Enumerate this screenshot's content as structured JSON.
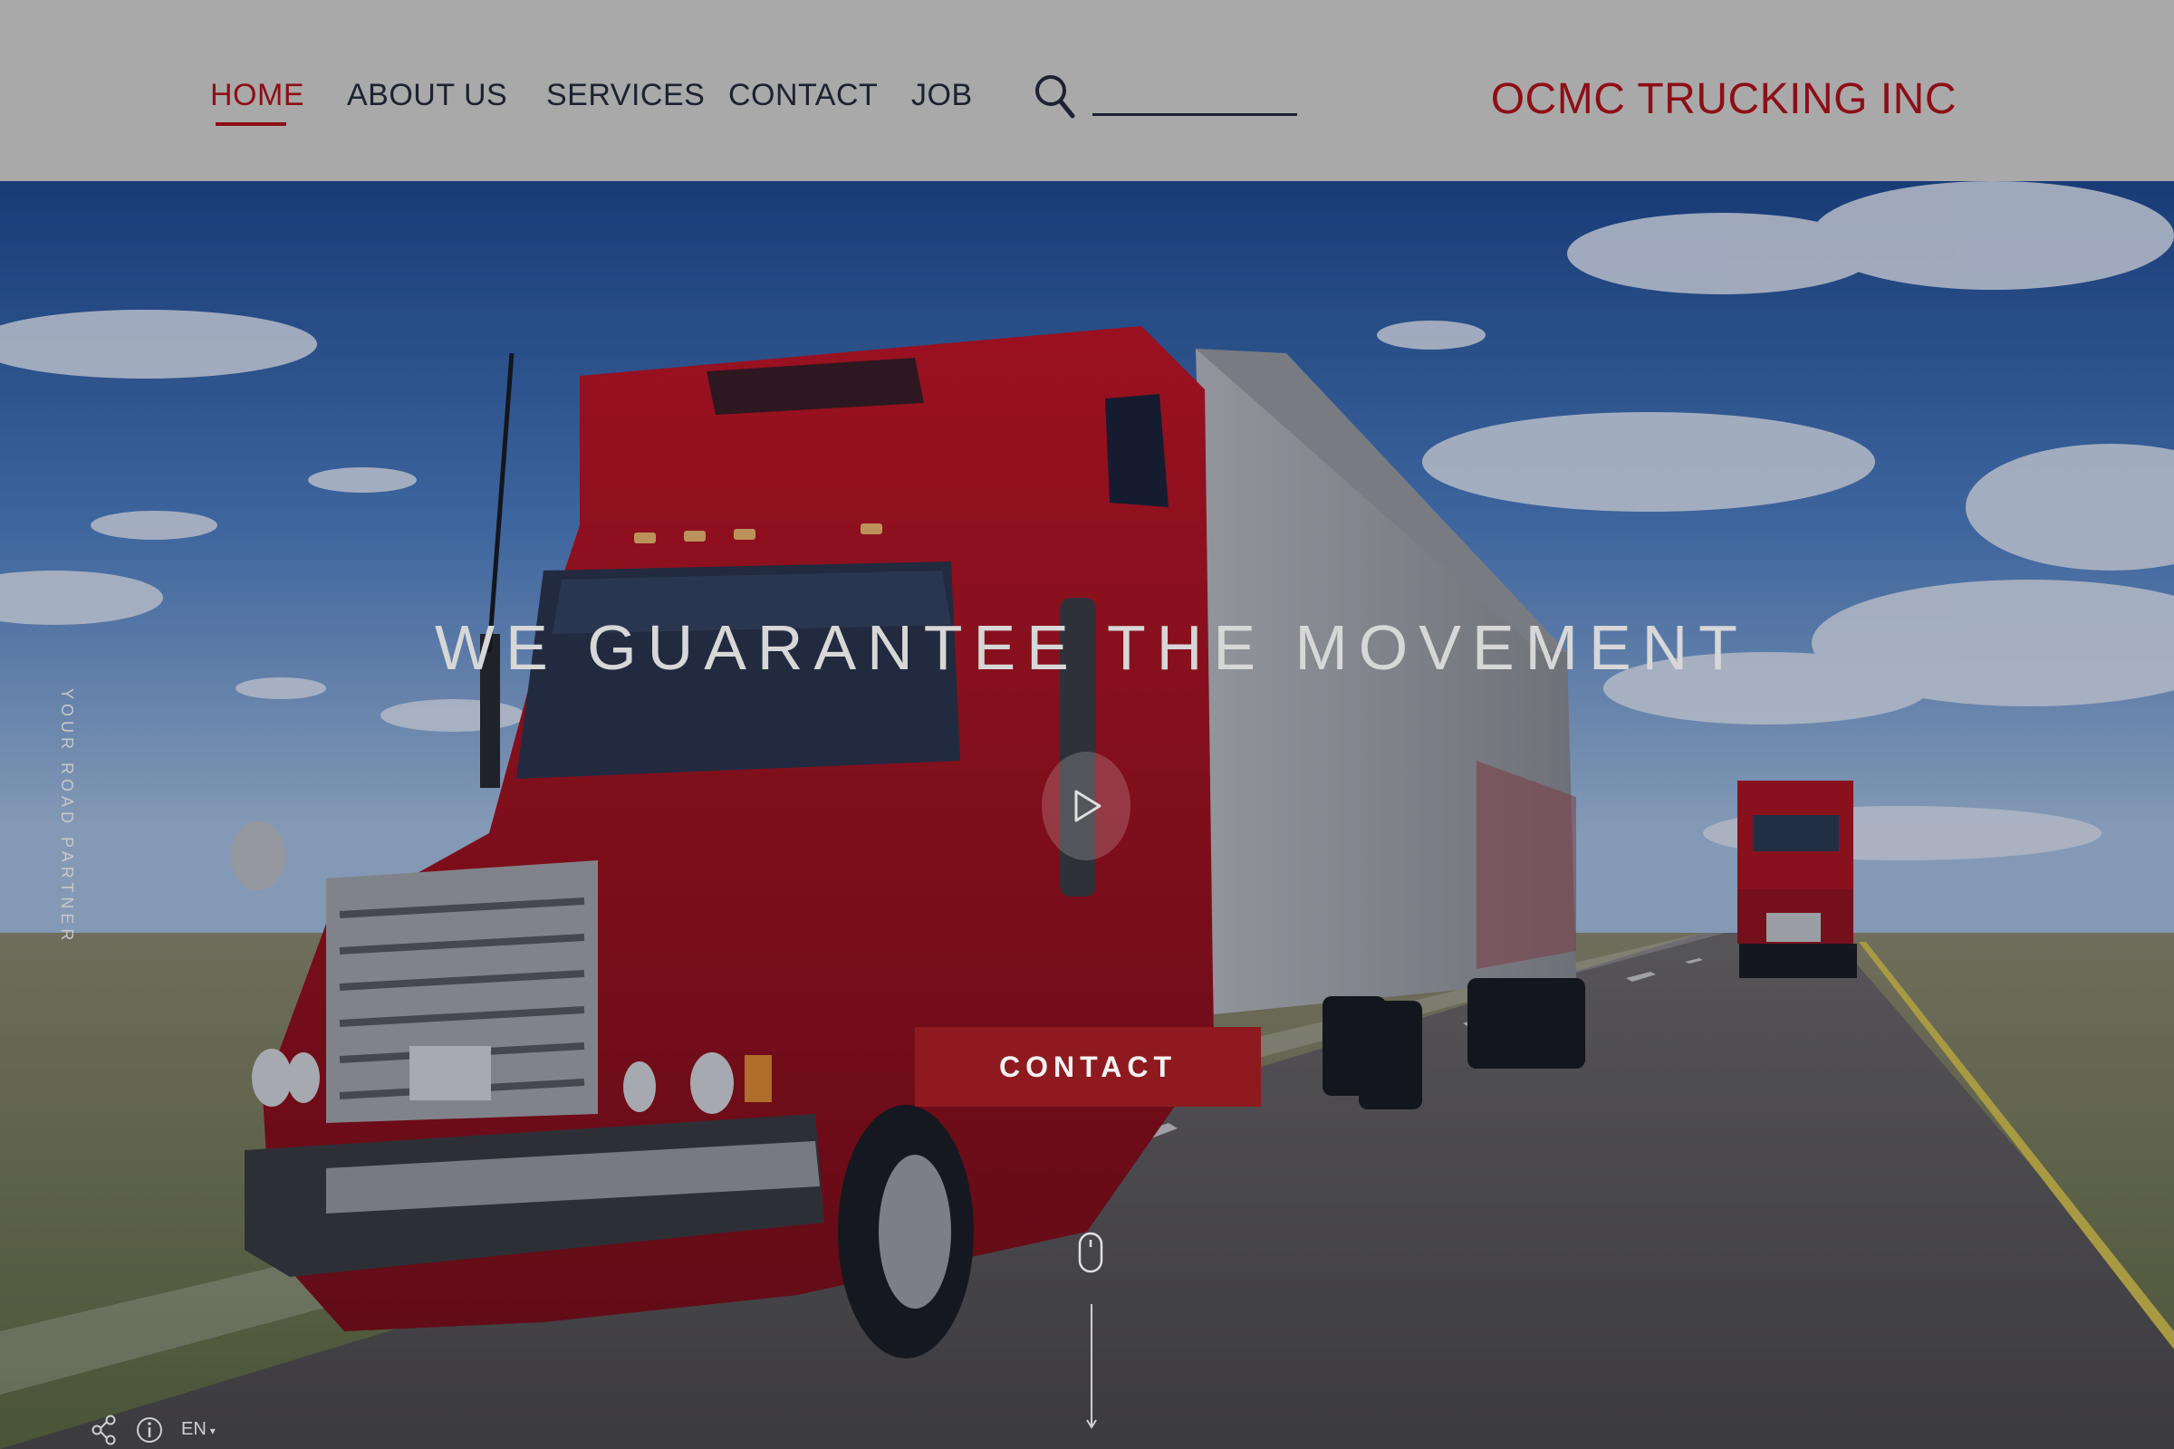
{
  "nav": {
    "items": [
      {
        "label": "HOME",
        "active": true
      },
      {
        "label": "ABOUT US",
        "active": false
      },
      {
        "label": "SERVICES",
        "active": false
      },
      {
        "label": "CONTACT",
        "active": false
      },
      {
        "label": "JOB",
        "active": false
      }
    ],
    "search": {
      "value": "",
      "placeholder": "",
      "icon": "search-icon"
    }
  },
  "brand": {
    "name": "OCMC TRUCKING INC"
  },
  "hero": {
    "headline": "WE GUARANTEE THE MOVEMENT",
    "cta_label": "CONTACT",
    "side_tagline": "YOUR ROAD PARTNER",
    "play_icon": "play-icon",
    "scroll_icon": "mouse-icon"
  },
  "footer": {
    "share_icon": "share-icon",
    "info_icon": "info-icon",
    "language": "EN"
  },
  "colors": {
    "accent": "#8e0e16",
    "header_bg": "#a9a9a9",
    "nav_text": "#1c2230",
    "cta_bg": "#8e1a1f"
  }
}
